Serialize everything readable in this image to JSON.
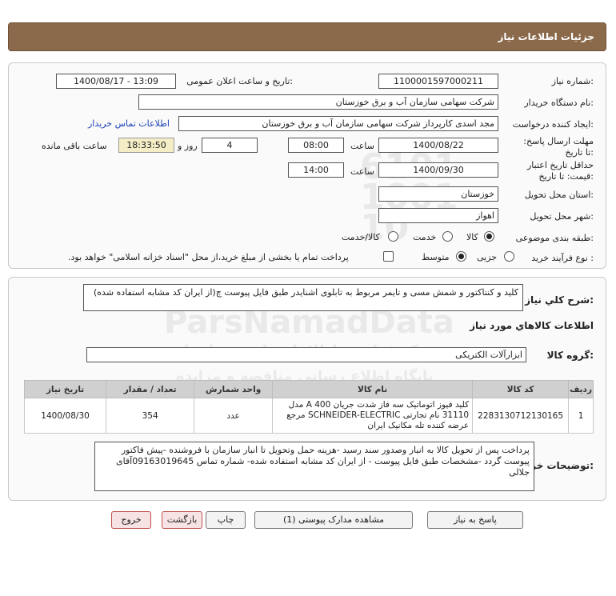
{
  "header": {
    "title": "جزئیات اطلاعات نیاز"
  },
  "fields": {
    "need_number_label": "شماره نیاز:",
    "need_number": "1100001597000211",
    "announce_label": "تاریخ و ساعت اعلان عمومی:",
    "announce_value": "1400/08/17 - 13:09",
    "buyer_org_label": "نام دستگاه خریدار:",
    "buyer_org": "شرکت سهامی سازمان آب و برق خوزستان",
    "requester_label": "ایجاد کننده درخواست:",
    "requester": "مجد اسدی کارپرداز شرکت سهامی سازمان آب و برق خوزستان",
    "contact_link": "اطلاعات تماس خریدار",
    "deadline_label": "مهلت ارسال پاسخ: تا تاریخ:",
    "deadline_date": "1400/08/22",
    "time_label": "ساعت",
    "deadline_time": "08:00",
    "days_value": "4",
    "days_label": "روز و",
    "remaining_time": "18:33:50",
    "remaining_label": "ساعت باقی مانده",
    "validity_label": "حداقل تاریخ اعتبار قیمت: تا تاریخ:",
    "validity_date": "1400/09/30",
    "validity_time_label": "ساعت",
    "validity_time": "14:00",
    "province_label": "استان محل تحویل:",
    "province": "خوزستان",
    "city_label": "شهر محل تحویل:",
    "city": "اهواز",
    "category_label": "طبقه بندی موضوعی:",
    "category_options": [
      "کالا",
      "خدمت",
      "کالا/خدمت"
    ],
    "category_selected": "کالا",
    "process_label": "نوع فرآیند خرید :",
    "process_options": [
      "جزیی",
      "متوسط"
    ],
    "process_selected": "متوسط",
    "payment_note": "پرداخت تمام یا بخشی از مبلغ خرید،از محل \"اسناد خزانه اسلامی\" خواهد بود."
  },
  "summary": {
    "label": "شرح کلي نياز:",
    "text": "کلید و کنتاکتور و شمش مسی و تایمر  مربوط به تابلوی اشنایدر طبق فایل پیوست چ(از ایران کد مشابه استفاده شده)"
  },
  "goods_info": {
    "title": "اطلاعات کالاهاي مورد نياز",
    "group_label": "گروه کالا:",
    "group_value": "ابزارآلات الکتریکی"
  },
  "table": {
    "headers": [
      "ردیف",
      "کد کالا",
      "نام کالا",
      "واحد شمارش",
      "تعداد / مقدار",
      "تاریخ نیاز"
    ],
    "rows": [
      {
        "row": "1",
        "code": "2283130712130165",
        "name": "کلید فیوز اتوماتیک سه فاز شدت جریان 400 A مدل 31110 نام تجارتی SCHNEIDER-ELECTRIC مرجع عرضه کننده تله مکانیک ایران",
        "unit": "عدد",
        "qty": "354",
        "date": "1400/08/30"
      }
    ]
  },
  "buyer_notes": {
    "label": "توضیحات خریدار:",
    "text": "پرداخت پس از تحویل کالا به انبار وصدور سند رسید -هزینه حمل وتحویل تا انبار سازمان با فروشنده -پیش فاکتور پیوست گردد -مشخصات طبق فایل پیوست - از ایران کد مشابه استفاده شده- شماره تماس 09163019645آقای جلالی"
  },
  "buttons": {
    "reply": "پاسخ به نیاز",
    "attachments": "مشاهده مدارک پیوستی (1)",
    "print": "چاپ",
    "back": "بازگشت",
    "exit": "خروج"
  }
}
